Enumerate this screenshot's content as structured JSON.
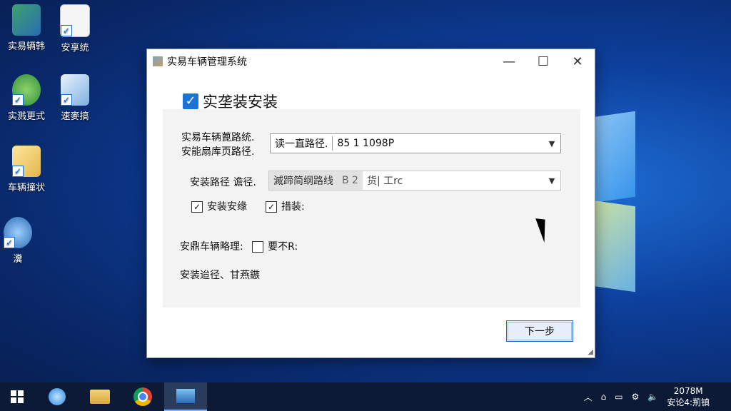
{
  "desktop": {
    "icons": [
      {
        "label": "实易辆韩"
      },
      {
        "label": "安享统"
      },
      {
        "label": "实溅更式"
      },
      {
        "label": "速麥搞"
      },
      {
        "label": "车辆撞状"
      },
      {
        "label": "瀵"
      }
    ]
  },
  "window": {
    "title": "实易车辆管理系统",
    "controls": {
      "minimize": "—",
      "maximize": "☐",
      "close": "✕"
    },
    "header_label": "实垄装安装",
    "row1": {
      "label_line1": "实易车辆蓖路统.",
      "label_line2": "安能扇库页路径.",
      "combo_prefix": "读一直路径.",
      "combo_value": "85 1 1098P"
    },
    "row2": {
      "label": "安装路径  谵径.",
      "combo_prefix": "滅蹄简纲路线",
      "combo_mid": "B 2",
      "combo_value": "货| 工rc"
    },
    "checkbox1_label": "安装安缘",
    "checkbox2_label": "措装:",
    "row3_label": "安鼎车辆略理:",
    "checkbox3_label": "要不R:",
    "note": "安装迨径、甘燕鏃",
    "next_button": "下一步"
  },
  "taskbar": {
    "clock_time": "2078M",
    "clock_date": "安论4:荊镇"
  },
  "colors": {
    "accent": "#1a73d9",
    "taskbar": "#0c1a36"
  }
}
